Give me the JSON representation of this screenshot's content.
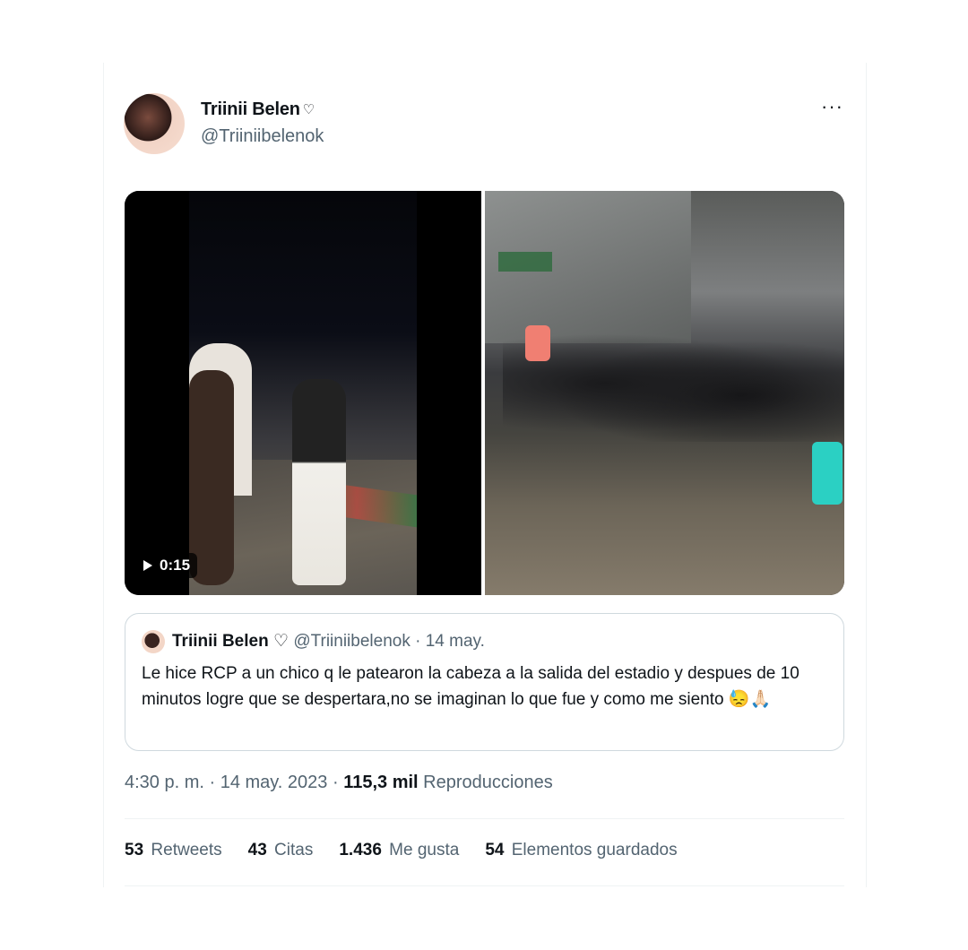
{
  "author": {
    "name": "Triinii Belen",
    "heart": "♡",
    "handle": "@Triiniibelenok"
  },
  "more_icon": "···",
  "media": {
    "duration": "0:15"
  },
  "quoted_tweet": {
    "name": "Triinii Belen",
    "heart": "♡",
    "meta": "@Triiniibelenok · 14 may.",
    "text": "Le hice RCP a un chico q le patearon  la cabeza a la salida del estadio y despues de 10 minutos logre que se despertara,no se imaginan lo que fue y como me siento 😓🙏🏻"
  },
  "timestamp": {
    "time_date": "4:30 p. m. · 14 may. 2023 · ",
    "views_count": "115,3 mil",
    "views_label": "Reproducciones"
  },
  "stats": [
    {
      "count": "53",
      "label": "Retweets"
    },
    {
      "count": "43",
      "label": "Citas"
    },
    {
      "count": "1.436",
      "label": "Me gusta"
    },
    {
      "count": "54",
      "label": "Elementos guardados"
    }
  ]
}
